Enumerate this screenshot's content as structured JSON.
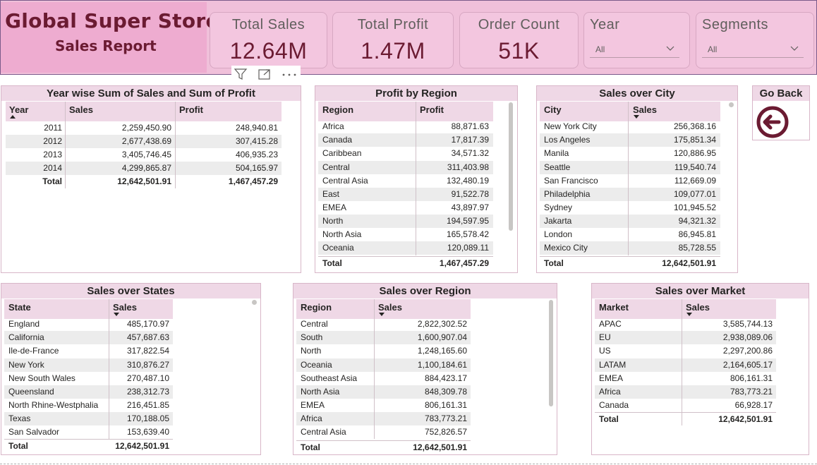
{
  "header": {
    "title": "Global Super Store",
    "subtitle": "Sales Report",
    "cards": [
      {
        "label": "Total Sales",
        "value": "12.64M"
      },
      {
        "label": "Total Profit",
        "value": "1.47M"
      },
      {
        "label": "Order Count",
        "value": "51K"
      }
    ],
    "slicers": [
      {
        "label": "Year",
        "value": "All"
      },
      {
        "label": "Segments",
        "value": "All"
      }
    ]
  },
  "colors": {
    "accent": "#6b1b32",
    "header_bg": "#f0c0da",
    "title_bg": "#eeacd0",
    "table_header_bg": "#efd8e6"
  },
  "visual_header_icons": [
    "filter-icon",
    "focus-mode-icon",
    "more-options-icon"
  ],
  "go_back": {
    "label": "Go Back",
    "icon": "arrow-left-circle-icon"
  },
  "tables": {
    "year": {
      "title": "Year wise Sum of Sales and Sum of Profit",
      "columns": [
        "Year",
        "Sales",
        "Profit"
      ],
      "rows": [
        [
          "2011",
          "2,259,450.90",
          "248,940.81"
        ],
        [
          "2012",
          "2,677,438.69",
          "307,415.28"
        ],
        [
          "2013",
          "3,405,746.45",
          "406,935.23"
        ],
        [
          "2014",
          "4,299,865.87",
          "504,165.97"
        ]
      ],
      "total": [
        "Total",
        "12,642,501.91",
        "1,467,457.29"
      ]
    },
    "profit_region": {
      "title": "Profit by Region",
      "columns": [
        "Region",
        "Profit"
      ],
      "rows": [
        [
          "Africa",
          "88,871.63"
        ],
        [
          "Canada",
          "17,817.39"
        ],
        [
          "Caribbean",
          "34,571.32"
        ],
        [
          "Central",
          "311,403.98"
        ],
        [
          "Central Asia",
          "132,480.19"
        ],
        [
          "East",
          "91,522.78"
        ],
        [
          "EMEA",
          "43,897.97"
        ],
        [
          "North",
          "194,597.95"
        ],
        [
          "North Asia",
          "165,578.42"
        ],
        [
          "Oceania",
          "120,089.11"
        ]
      ],
      "total": [
        "Total",
        "1,467,457.29"
      ]
    },
    "city": {
      "title": "Sales over City",
      "columns": [
        "City",
        "Sales"
      ],
      "rows": [
        [
          "New York City",
          "256,368.16"
        ],
        [
          "Los Angeles",
          "175,851.34"
        ],
        [
          "Manila",
          "120,886.95"
        ],
        [
          "Seattle",
          "119,540.74"
        ],
        [
          "San Francisco",
          "112,669.09"
        ],
        [
          "Philadelphia",
          "109,077.01"
        ],
        [
          "Sydney",
          "101,945.52"
        ],
        [
          "Jakarta",
          "94,321.32"
        ],
        [
          "London",
          "86,945.81"
        ],
        [
          "Mexico City",
          "85,728.55"
        ]
      ],
      "total": [
        "Total",
        "12,642,501.91"
      ]
    },
    "states": {
      "title": "Sales over States",
      "columns": [
        "State",
        "Sales"
      ],
      "rows": [
        [
          "England",
          "485,170.97"
        ],
        [
          "California",
          "457,687.63"
        ],
        [
          "Ile-de-France",
          "317,822.54"
        ],
        [
          "New York",
          "310,876.27"
        ],
        [
          "New South Wales",
          "270,487.10"
        ],
        [
          "Queensland",
          "238,312.73"
        ],
        [
          "North Rhine-Westphalia",
          "216,451.85"
        ],
        [
          "Texas",
          "170,188.05"
        ],
        [
          "San Salvador",
          "153,639.40"
        ]
      ],
      "total": [
        "Total",
        "12,642,501.91"
      ]
    },
    "sales_region": {
      "title": "Sales over Region",
      "columns": [
        "Region",
        "Sales"
      ],
      "rows": [
        [
          "Central",
          "2,822,302.52"
        ],
        [
          "South",
          "1,600,907.04"
        ],
        [
          "North",
          "1,248,165.60"
        ],
        [
          "Oceania",
          "1,100,184.61"
        ],
        [
          "Southeast Asia",
          "884,423.17"
        ],
        [
          "North Asia",
          "848,309.78"
        ],
        [
          "EMEA",
          "806,161.31"
        ],
        [
          "Africa",
          "783,773.21"
        ],
        [
          "Central Asia",
          "752,826.57"
        ]
      ],
      "total": [
        "Total",
        "12,642,501.91"
      ]
    },
    "market": {
      "title": "Sales over Market",
      "columns": [
        "Market",
        "Sales"
      ],
      "rows": [
        [
          "APAC",
          "3,585,744.13"
        ],
        [
          "EU",
          "2,938,089.06"
        ],
        [
          "US",
          "2,297,200.86"
        ],
        [
          "LATAM",
          "2,164,605.17"
        ],
        [
          "EMEA",
          "806,161.31"
        ],
        [
          "Africa",
          "783,773.21"
        ],
        [
          "Canada",
          "66,928.17"
        ]
      ],
      "total": [
        "Total",
        "12,642,501.91"
      ]
    }
  }
}
